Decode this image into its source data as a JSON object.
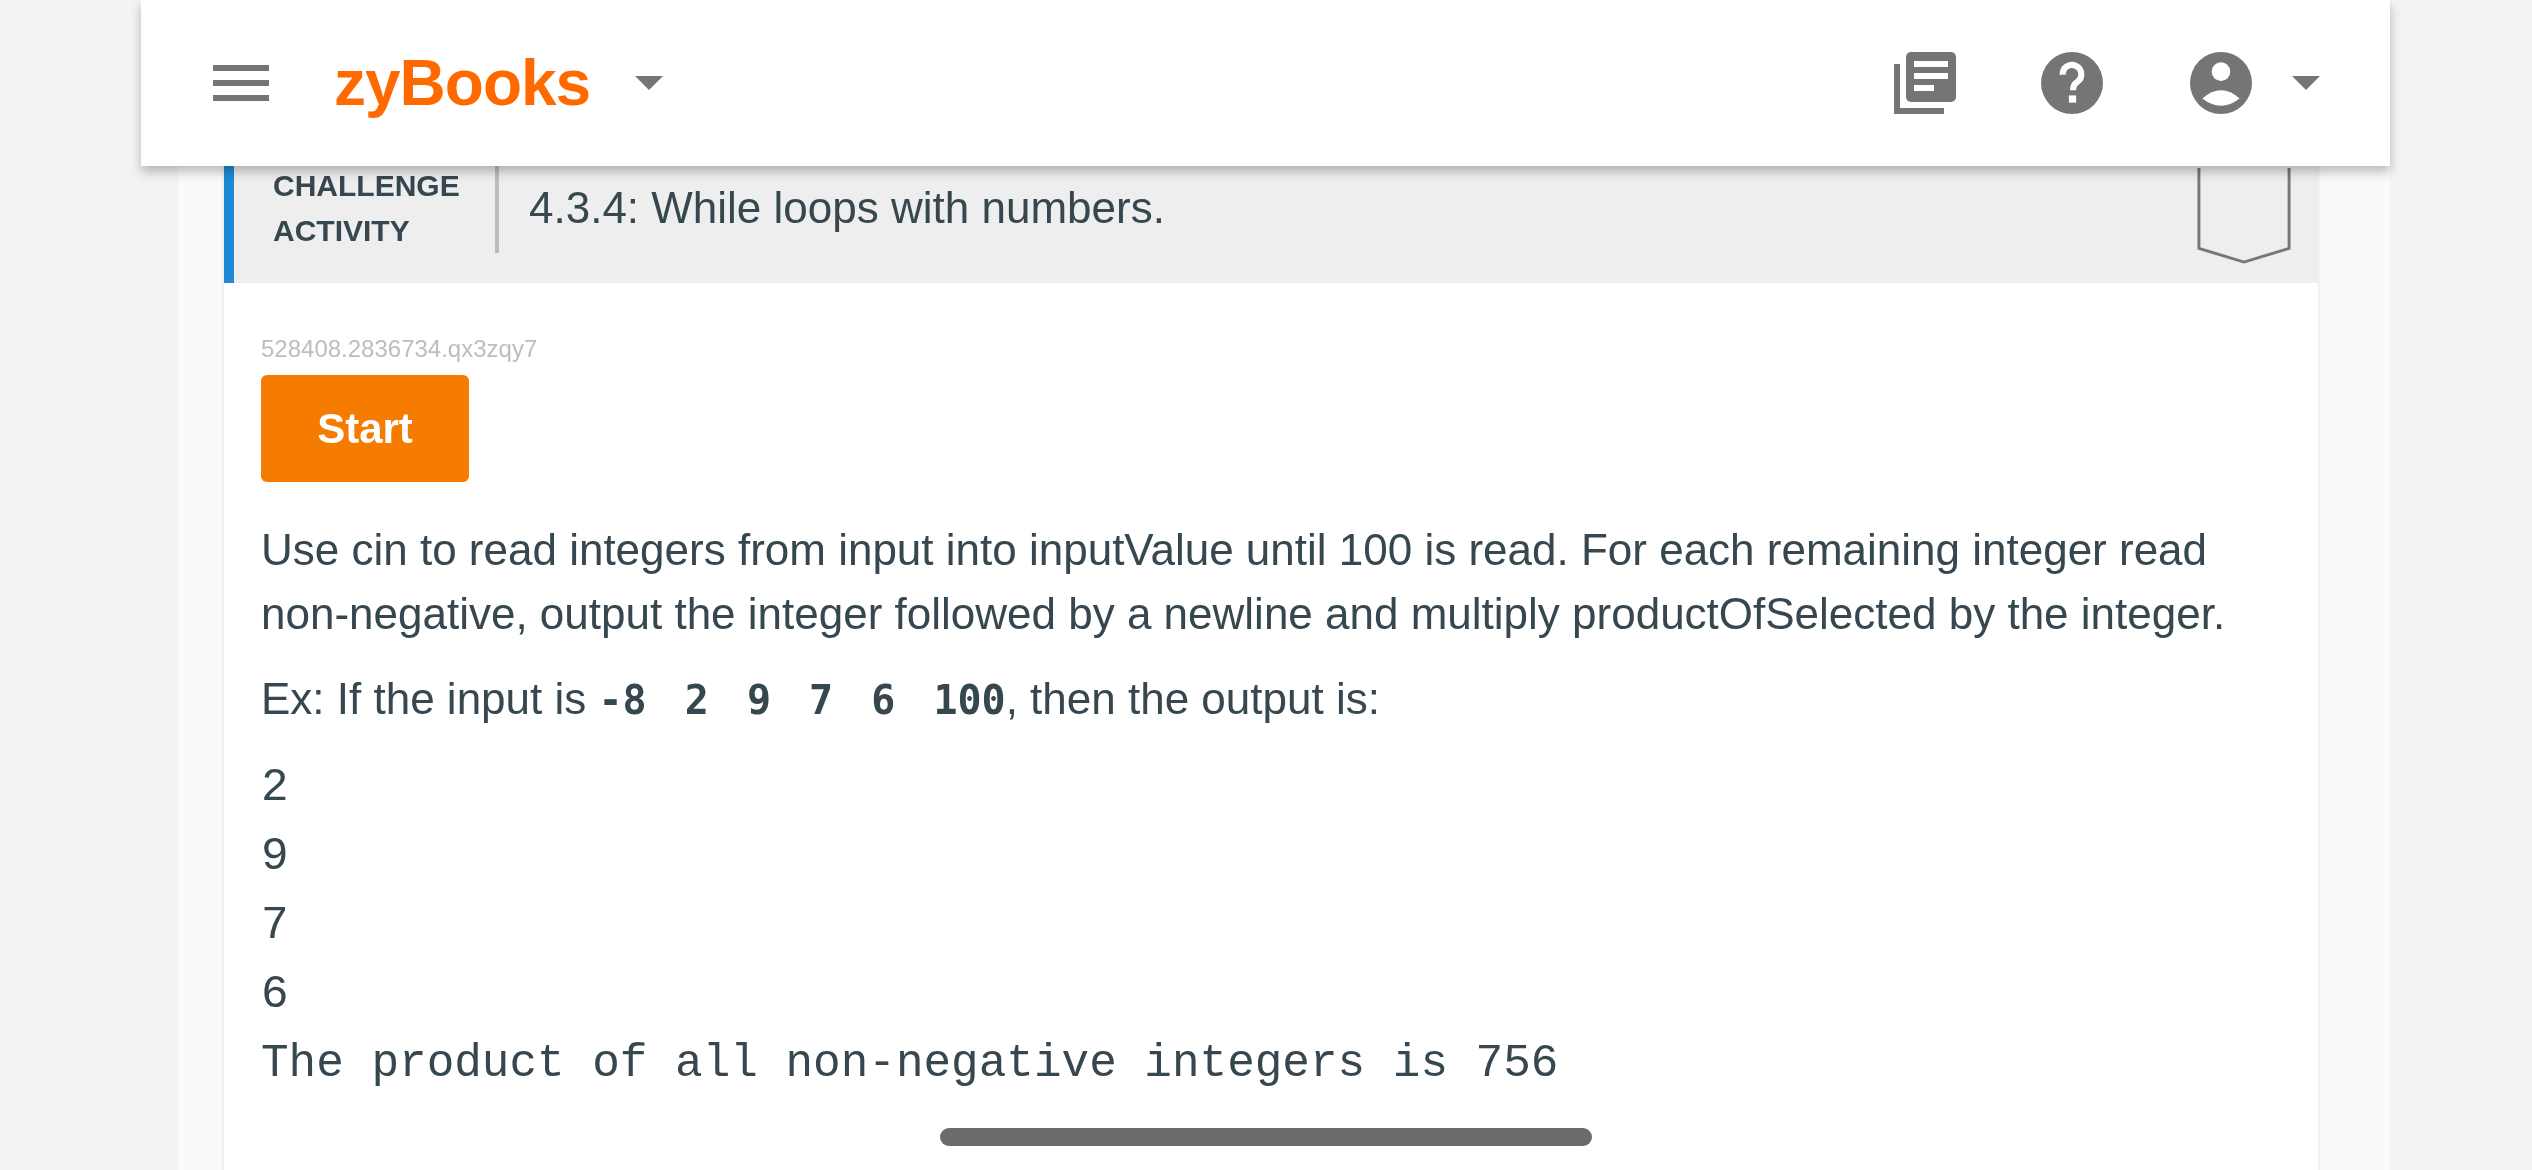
{
  "header": {
    "logo": "zyBooks"
  },
  "activity": {
    "type_label": "CHALLENGE ACTIVITY",
    "title": "4.3.4: While loops with numbers.",
    "id": "528408.2836734.qx3zqy7",
    "start_button": "Start",
    "instructions": "Use cin to read integers from input into inputValue until 100 is read. For each remaining integer read non-negative, output the integer followed by a newline and multiply productOfSelected by the integer.",
    "example": {
      "prefix": "Ex: If the input is ",
      "input": "-8 2 9 7 6 100",
      "suffix": ", then the output is:"
    },
    "output_lines": [
      "2",
      "9",
      "7",
      "6",
      "The product of all non-negative integers is 756"
    ]
  }
}
